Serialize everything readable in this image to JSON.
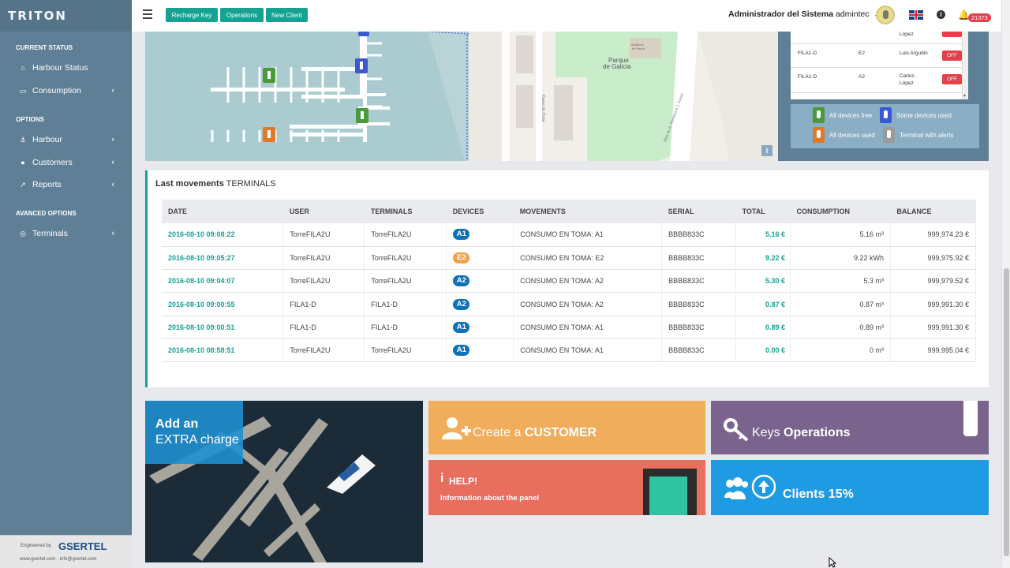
{
  "app": {
    "brand": "TRITON"
  },
  "sidebar": {
    "sections": {
      "current_status": "CURRENT STATUS",
      "options": "OPTIONS",
      "advanced": "AVANCED OPTIONS"
    },
    "items": [
      {
        "label": "Harbour Status",
        "icon": "home-icon"
      },
      {
        "label": "Consumption",
        "icon": "battery-icon"
      },
      {
        "label": "Harbour",
        "icon": "anchor-icon"
      },
      {
        "label": "Customers",
        "icon": "users-icon"
      },
      {
        "label": "Reports",
        "icon": "chart-icon"
      },
      {
        "label": "Terminals",
        "icon": "target-icon"
      }
    ],
    "footer": {
      "engineered": "Engineered by",
      "company": "GSERTEL",
      "web": "www.gsertel.com - info@gsertel.com"
    }
  },
  "topbar": {
    "buttons": [
      "Recharge Key",
      "Operations",
      "New Client"
    ],
    "user_role": "Administrador del Sistema",
    "user_name": "admintec",
    "notifications": "21373"
  },
  "map": {
    "park_label_1": "Parque",
    "park_label_2": "de Galicia",
    "auditorium_1": "Auditorio",
    "auditorium_2": "de Ferrol",
    "street_1": "Paseo do Porto",
    "street_2": "Rúa de A. Romero e J. Freire",
    "info": "i"
  },
  "terminal_list": [
    {
      "terminal": "",
      "device": "",
      "user": "López",
      "state": ""
    },
    {
      "terminal": "FILA1-D",
      "device": "E2",
      "user": "Luis Argudin",
      "state": "OFF"
    },
    {
      "terminal": "FILA1-D",
      "device": "A2",
      "user_1": "Carlos",
      "user_2": "López",
      "state": "OFF"
    }
  ],
  "legend": {
    "free": "All devices free",
    "some": "Some devices used",
    "all": "All devices used",
    "alerts": "Terminal with alerts",
    "colors": {
      "free": "#4a9a3c",
      "some": "#3a57d4",
      "all": "#e07a28",
      "alerts": "#9a9a9a"
    }
  },
  "movements": {
    "title_bold": "Last movements",
    "title_rest": "TERMINALS",
    "columns": [
      "DATE",
      "USER",
      "TERMINALS",
      "DEVICES",
      "MOVEMENTS",
      "SERIAL",
      "TOTAL",
      "CONSUMPTION",
      "BALANCE"
    ],
    "rows": [
      {
        "date": "2016-08-10 09:08:22",
        "user": "TorreFILA2U",
        "terminal": "TorreFILA2U",
        "device": "A1",
        "movement": "CONSUMO EN TOMA: A1",
        "serial": "BBBB833C",
        "total": "5.16 €",
        "consumption": "5.16 m³",
        "balance": "999,974.23 €"
      },
      {
        "date": "2016-08-10 09:05:27",
        "user": "TorreFILA2U",
        "terminal": "TorreFILA2U",
        "device": "E2",
        "movement": "CONSUMO EN TOMA: E2",
        "serial": "BBBB833C",
        "total": "9.22 €",
        "consumption": "9.22 kWh",
        "balance": "999,975.92 €"
      },
      {
        "date": "2016-08-10 09:04:07",
        "user": "TorreFILA2U",
        "terminal": "TorreFILA2U",
        "device": "A2",
        "movement": "CONSUMO EN TOMA: A2",
        "serial": "BBBB833C",
        "total": "5.30 €",
        "consumption": "5.3 m³",
        "balance": "999,979.52 €"
      },
      {
        "date": "2016-08-10 09:00:55",
        "user": "FILA1-D",
        "terminal": "FILA1-D",
        "device": "A2",
        "movement": "CONSUMO EN TOMA: A2",
        "serial": "BBBB833C",
        "total": "0.87 €",
        "consumption": "0.87 m³",
        "balance": "999,991.30 €"
      },
      {
        "date": "2016-08-10 09:00:51",
        "user": "FILA1-D",
        "terminal": "FILA1-D",
        "device": "A1",
        "movement": "CONSUMO EN TOMA: A1",
        "serial": "BBBB833C",
        "total": "0.89 €",
        "consumption": "0.89 m³",
        "balance": "999,991.30 €"
      },
      {
        "date": "2016-08-10 08:58:51",
        "user": "TorreFILA2U",
        "terminal": "TorreFILA2U",
        "device": "A1",
        "movement": "CONSUMO EN TOMA: A1",
        "serial": "BBBB833C",
        "total": "0.00 €",
        "consumption": "0 m³",
        "balance": "999,995.04 €"
      }
    ]
  },
  "tiles": {
    "extra_1": "Add an",
    "extra_2": "EXTRA charge",
    "create_1": "Create a",
    "create_2": "CUSTOMER",
    "keys_1": "Keys",
    "keys_2": "Operations",
    "help_title": "HELP!",
    "help_sub": "Information about the panel",
    "clients": "Clients 15%"
  }
}
